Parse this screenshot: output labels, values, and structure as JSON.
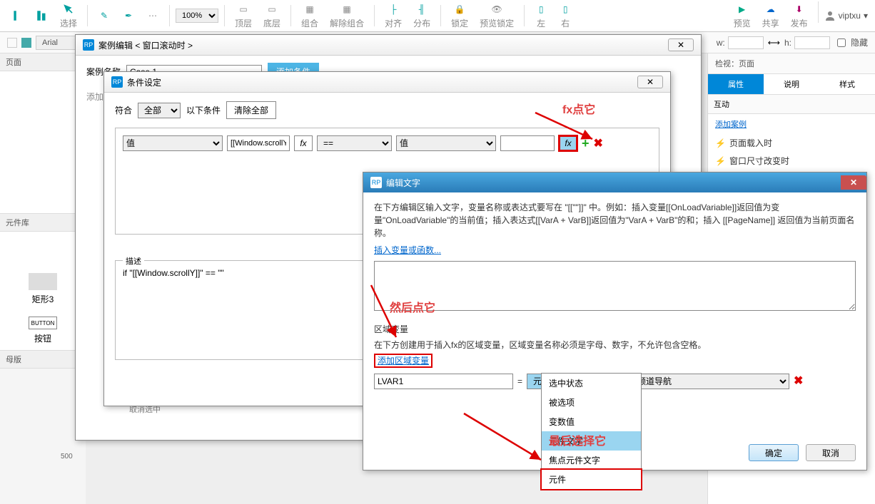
{
  "toolbar": {
    "select_label": "选择",
    "zoom_value": "100%",
    "groups": [
      "顶层",
      "底层",
      "组合",
      "解除组合",
      "对齐",
      "分布",
      "锁定",
      "预览锁定",
      "左",
      "右"
    ],
    "right_buttons": {
      "preview": "预览",
      "share": "共享",
      "publish": "发布"
    },
    "user": "viptxu"
  },
  "secbar": {
    "font": "Arial",
    "w_label": "w:",
    "h_label": "h:",
    "hidden_label": "隐藏"
  },
  "left": {
    "pages_header": "页面",
    "lib_header": "元件库",
    "shape_label": "矩形3",
    "button_inner": "BUTTON",
    "button_label": "按钮",
    "master_header": "母版"
  },
  "right": {
    "checkview": "检视：页面",
    "tabs": {
      "props": "属性",
      "notes": "说明",
      "style": "样式"
    },
    "interaction_hdr": "互动",
    "add_case": "添加案例",
    "event1": "页面载入时",
    "event2": "窗口尺寸改变时"
  },
  "ruler": {
    "n500": "500"
  },
  "dlg1": {
    "title": "案例编辑 < 窗口滚动时  >",
    "case_name_label": "案例名称",
    "case_name_value": "Case 1",
    "add_cond_btn": "添加条件",
    "add_action": "添加动作",
    "cancel_sel": "取消选中"
  },
  "dlg2": {
    "title": "条件设定",
    "match_label": "符合",
    "match_value": "全部",
    "match_suffix": "以下条件",
    "clear_btn": "清除全部",
    "cond_type": "值",
    "cond_expr": "[[Window.scrollY",
    "fx": "fx",
    "cond_op": "==",
    "cond_type2": "值",
    "desc_legend": "描述",
    "desc_text": "if \"[[Window.scrollY]]\" == \"\""
  },
  "dlg3": {
    "title": "编辑文字",
    "instruction": "在下方编辑区输入文字，变量名称或表达式要写在 \"[[\"\"]]\" 中。例如：插入变量[[OnLoadVariable]]返回值为变量\"OnLoadVariable\"的当前值；插入表达式[[VarA + VarB]]返回值为\"VarA + VarB\"的和；插入 [[PageName]] 返回值为当前页面名称。",
    "insert_link": "插入变量或函数...",
    "region_var_hdr": "区域变量",
    "region_var_desc": "在下方创建用于插入fx的区域变量，区域变量名称必须是字母、数字，不允许包含空格。",
    "add_region_var": "添加区域变量",
    "var_name": "LVAR1",
    "eq": "=",
    "var_type": "元件文字",
    "target": "频道导航",
    "ok": "确定",
    "cancel": "取消"
  },
  "dropdown": {
    "items": [
      "选中状态",
      "被选项",
      "变数值",
      "元件文字",
      "焦点元件文字",
      "元件"
    ]
  },
  "annotations": {
    "fx_note": "fx点它",
    "then_note": "然后点它",
    "finally_note": "最后选择它"
  }
}
